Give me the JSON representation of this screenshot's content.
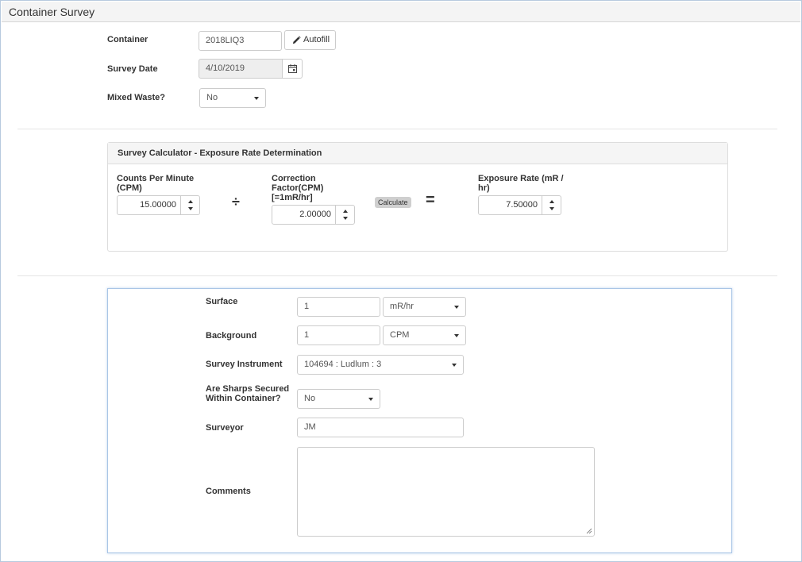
{
  "window": {
    "title": "Container Survey"
  },
  "header_form": {
    "container": {
      "label": "Container",
      "value": "2018LIQ3",
      "autofill_label": "Autofill",
      "autofill_icon": "pencil-icon"
    },
    "survey_date": {
      "label": "Survey Date",
      "value": "4/10/2019",
      "icon": "calendar-icon"
    },
    "mixed_waste": {
      "label": "Mixed Waste?",
      "value": "No"
    }
  },
  "calculator": {
    "title": "Survey Calculator - Exposure Rate Determination",
    "cpm": {
      "label_line1": "Counts Per Minute",
      "label_line2": "(CPM)",
      "value": "15.00000"
    },
    "divide_symbol": "÷",
    "correction": {
      "label_line1": "Correction",
      "label_line2": "Factor(CPM)",
      "label_line3": "[=1mR/hr]",
      "value": "2.00000"
    },
    "calculate_label": "Calculate",
    "equals_symbol": "=",
    "exposure": {
      "label_line1": "Exposure Rate (mR /",
      "label_line2": "hr)",
      "value": "7.50000"
    }
  },
  "survey_form": {
    "surface": {
      "label": "Surface",
      "value": "1",
      "unit": "mR/hr"
    },
    "background": {
      "label": "Background",
      "value": "1",
      "unit": "CPM"
    },
    "instrument": {
      "label": "Survey Instrument",
      "value": "104694 : Ludlum : 3"
    },
    "sharps": {
      "label_line1": "Are Sharps Secured",
      "label_line2": "Within Container?",
      "value": "No"
    },
    "surveyor": {
      "label": "Surveyor",
      "value": "JM"
    },
    "comments": {
      "label": "Comments",
      "value": ""
    }
  }
}
